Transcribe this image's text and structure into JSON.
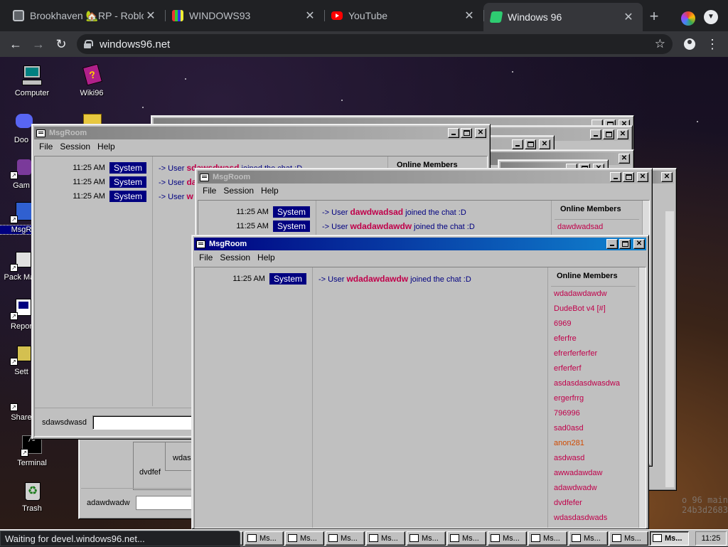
{
  "browser": {
    "tabs": [
      {
        "title": "Brookhaven 🏡RP - Roblox",
        "favicon": "roblox-icon",
        "color": "#5f6368"
      },
      {
        "title": "WINDOWS93",
        "favicon": "windows93-icon",
        "color": "#d0c020"
      },
      {
        "title": "YouTube",
        "favicon": "youtube-icon",
        "color": "#ff0000"
      },
      {
        "title": "Windows 96",
        "favicon": "windows96-icon",
        "color": "#2ecc71"
      }
    ],
    "url": "windows96.net",
    "status": "Waiting for devel.windows96.net..."
  },
  "desktop": {
    "icons": [
      {
        "label": "Computer",
        "icon": "computer-icon"
      },
      {
        "label": "Wiki96",
        "icon": "wiki-book-icon"
      },
      {
        "label": "Doo",
        "icon": "discord-icon"
      },
      {
        "label": "Gam",
        "icon": "games-icon"
      },
      {
        "label": "MsgR",
        "icon": "msgroom-icon"
      },
      {
        "label": "Pack Man",
        "icon": "package-manager-icon"
      },
      {
        "label": "Repor",
        "icon": "report-icon"
      },
      {
        "label": "Sett",
        "icon": "settings-icon"
      },
      {
        "label": "Share",
        "icon": "share-icon"
      },
      {
        "label": "Terminal",
        "icon": "terminal-icon"
      },
      {
        "label": "Trash",
        "icon": "recycle-bin-icon"
      }
    ],
    "watermark_line1": "o 96 main",
    "watermark_line2": "24b3d2683"
  },
  "menu": {
    "file": "File",
    "session": "Session",
    "help": "Help"
  },
  "windows": {
    "back": {
      "title": "MsgRoom",
      "rows": [
        {
          "time": "11:25 AM",
          "tag": "System",
          "prefix": "-> User ",
          "user": "sdawsdwasd",
          "suffix": " joined the chat :D"
        },
        {
          "time": "11:25 AM",
          "tag": "System",
          "prefix": "-> User ",
          "user": "da",
          "suffix": ""
        },
        {
          "time": "11:25 AM",
          "tag": "System",
          "prefix": "-> User ",
          "user": "w",
          "suffix": ""
        }
      ],
      "members_heading": "Online Members",
      "username": "sdawsdwasd"
    },
    "behind": {
      "username": "adawdwadw",
      "name_a": "dvdfef",
      "name_b": "wdas"
    },
    "middle": {
      "title": "MsgRoom",
      "rows": [
        {
          "time": "11:25 AM",
          "tag": "System",
          "prefix": "-> User ",
          "user": "dawdwadsad",
          "suffix": " joined the chat :D"
        },
        {
          "time": "11:25 AM",
          "tag": "System",
          "prefix": "-> User ",
          "user": "wdadawdawdw",
          "suffix": " joined the chat :D"
        }
      ],
      "members_heading": "Online Members",
      "members": [
        "dawdwadsad"
      ]
    },
    "front": {
      "title": "MsgRoom",
      "rows": [
        {
          "time": "11:25 AM",
          "tag": "System",
          "prefix": "-> User ",
          "user": "wdadawdawdw",
          "suffix": " joined the chat :D"
        }
      ],
      "members_heading": "Online Members",
      "members": [
        "wdadawdawdw",
        "DudeBot v4 [#]",
        "6969",
        "eferfre",
        "efrerferferfer",
        "erferferf",
        "asdasdasdwasdwa",
        "ergerfrrg",
        "796996",
        "sad0asd",
        "anon281",
        "asdwasd",
        "awwadawdaw",
        "adawdwadw",
        "dvdfefer",
        "wdasdasdwads"
      ]
    }
  },
  "taskbar": {
    "item_label": "Ms...",
    "item_count": 17,
    "clock": "11:25"
  },
  "colors": {
    "accent": "#000080",
    "username": "#c0004a",
    "orange_member": "#d04a00"
  }
}
